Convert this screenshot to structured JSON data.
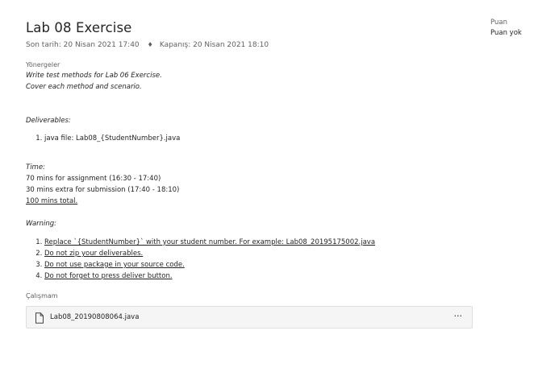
{
  "assignment": {
    "title": "Lab 08 Exercise",
    "due_date": "Son tarih: 20 Nisan 2021 17:40",
    "close_date": "Kapanış: 20 Nisan 2021 18:10",
    "separator": "♦"
  },
  "instructions": {
    "label": "Yönergeler",
    "lines": [
      "Write test methods for Lab 06 Exercise.",
      "Cover each method and scenario."
    ],
    "deliverables": {
      "heading": "Deliverables:",
      "items": [
        "java file: Lab08_{StudentNumber}.java"
      ]
    },
    "time": {
      "heading": "Time:",
      "lines": [
        "70 mins for assignment (16:30 - 17:40)",
        "30 mins extra for submission (17:40 - 18:10)",
        "100 mins total."
      ]
    },
    "warning": {
      "heading": "Warning:",
      "items": [
        "Replace `{StudentNumber}` with your student number. For example: Lab08_20195175002.java",
        "Do not zip your deliverables. ",
        "Do not use package in your source code.",
        "Do not forget to press deliver button."
      ]
    }
  },
  "work": {
    "label": "Çalışmam",
    "file_name": "Lab08_20190808064.java",
    "more_label": "···"
  },
  "points": {
    "label": "Puan",
    "value": "Puan yok"
  },
  "icons": {
    "file": "file-icon",
    "more": "more-options-icon"
  }
}
